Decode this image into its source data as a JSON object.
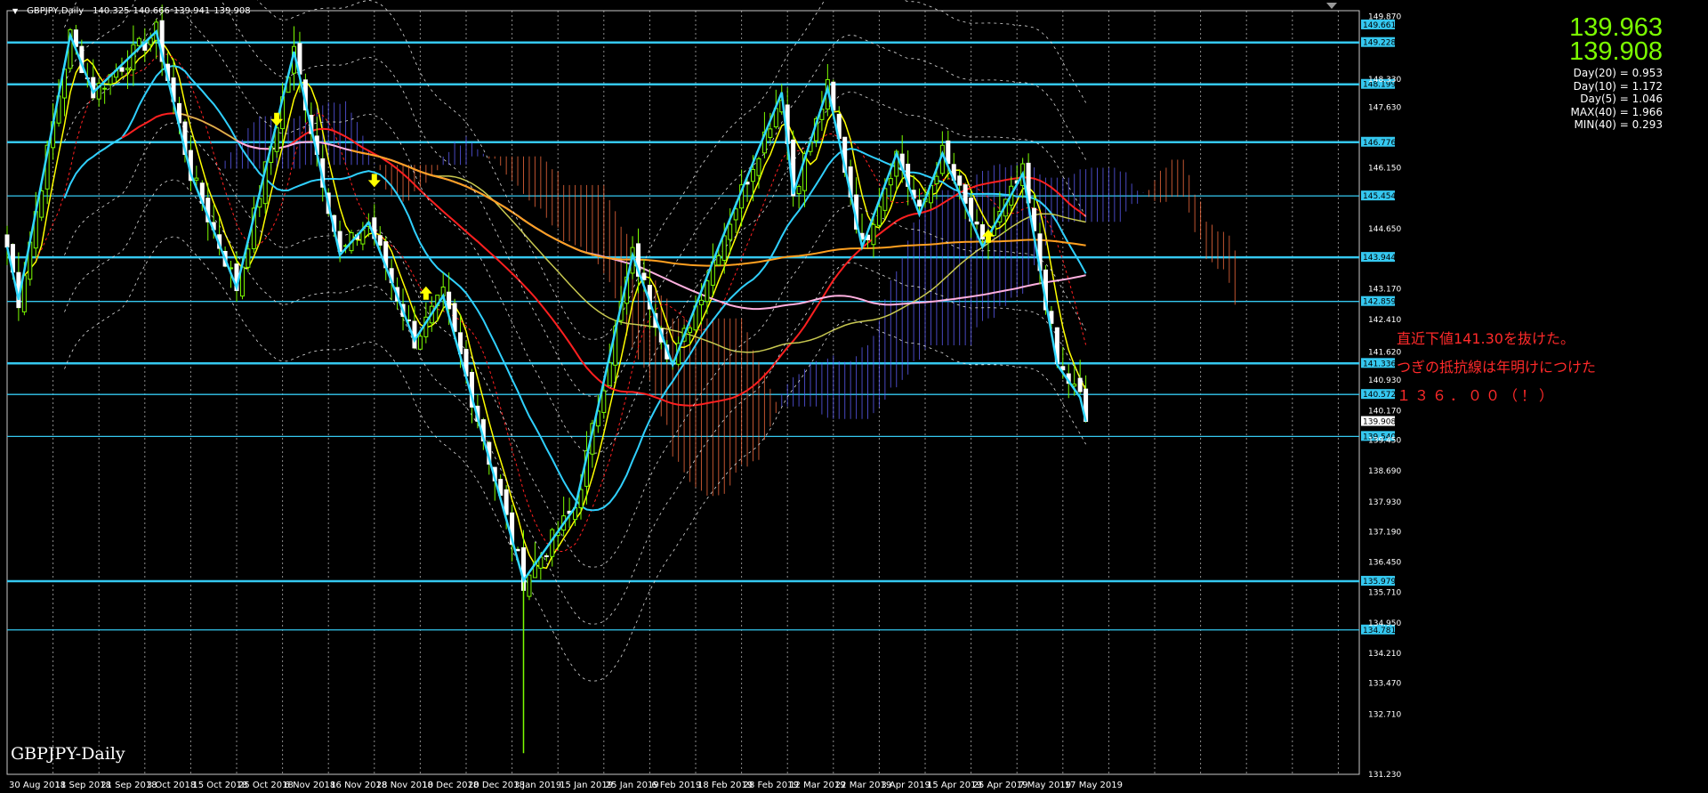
{
  "header": {
    "symbol": "GBPJPY,Daily",
    "open": "140.325",
    "high": "140.666",
    "low": "139.941",
    "close": "139.908"
  },
  "big_prices": {
    "ask": "139.963",
    "bid": "139.908"
  },
  "stats": [
    "Day(20) = 0.953",
    "Day(10) = 1.172",
    "Day(5) = 1.046",
    "MAX(40) = 1.966",
    "MIN(40) = 0.293"
  ],
  "annotation": {
    "line1": "直近下値141.30を抜けた。",
    "line2": "つぎの抵抗線は年明けにつけた",
    "line3": "１３６．００（！）"
  },
  "watermark": "GBPJPY-Daily",
  "colors": {
    "background": "#000000",
    "grid": "#c8c8c8",
    "level_line": "#35c8f0",
    "bull_candle": "#7cfc00",
    "bear_candle": "#ffffff",
    "big_price": "#7cfc00",
    "annotation": "#ff2a2a",
    "ma_yellow": "#ffff00",
    "ma_red": "#ff2020",
    "ma_cyan": "#30d0ff",
    "ma_orange": "#ffa020",
    "ma_pink": "#ffb0e0",
    "ma_olive": "#c8c850",
    "cloud_bull": "#6060ff",
    "cloud_bear": "#ff7040",
    "arrow": "#ffff00"
  },
  "chart_data": {
    "type": "candlestick",
    "title": "GBPJPY,Daily",
    "y_range": [
      131.23,
      150.01
    ],
    "y_ticks": [
      "149.870",
      "148.330",
      "147.630",
      "146.150",
      "144.650",
      "143.170",
      "142.410",
      "141.620",
      "140.930",
      "140.170",
      "139.450",
      "138.690",
      "137.930",
      "137.190",
      "136.450",
      "135.710",
      "134.950",
      "134.210",
      "133.470",
      "132.710",
      "131.230"
    ],
    "x_labels": [
      "30 Aug 2018",
      "11 Sep 2018",
      "21 Sep 2018",
      "3 Oct 2018",
      "15 Oct 2018",
      "25 Oct 2018",
      "6 Nov 2018",
      "16 Nov 2018",
      "28 Nov 2018",
      "10 Dec 2018",
      "20 Dec 2018",
      "3 Jan 2019",
      "15 Jan 2019",
      "25 Jan 2019",
      "6 Feb 2019",
      "18 Feb 2019",
      "28 Feb 2019",
      "12 Mar 2019",
      "22 Mar 2019",
      "3 Apr 2019",
      "15 Apr 2019",
      "25 Apr 2019",
      "7 May 2019",
      "17 May 2019"
    ],
    "x_label_days": [
      0,
      8,
      16,
      24,
      32,
      40,
      48,
      56,
      64,
      72,
      80,
      88,
      96,
      104,
      112,
      120,
      128,
      136,
      144,
      152,
      160,
      168,
      176,
      184
    ],
    "grid": "dotted vertical",
    "levels": [
      {
        "label": "149.661",
        "value": 149.661,
        "line": false
      },
      {
        "label": "149.228",
        "value": 149.228,
        "line": true
      },
      {
        "label": "148.199",
        "value": 148.199,
        "line": true
      },
      {
        "label": "146.776",
        "value": 146.776,
        "line": true
      },
      {
        "label": "145.454",
        "value": 145.454,
        "line": true
      },
      {
        "label": "143.944",
        "value": 143.944,
        "line": true
      },
      {
        "label": "142.859",
        "value": 142.859,
        "line": true
      },
      {
        "label": "141.336",
        "value": 141.336,
        "line": true
      },
      {
        "label": "140.572",
        "value": 140.572,
        "line": true
      },
      {
        "label": "139.540",
        "value": 139.54,
        "line": true
      },
      {
        "label": "135.979",
        "value": 135.979,
        "line": true
      },
      {
        "label": "134.781",
        "value": 134.781,
        "line": true
      }
    ],
    "current_price": {
      "label": "139.908",
      "value": 139.908
    },
    "pivots": [
      {
        "day": 0,
        "price": 144.2
      },
      {
        "day": 2,
        "price": 142.9
      },
      {
        "day": 11,
        "price": 149.4
      },
      {
        "day": 15,
        "price": 148.0
      },
      {
        "day": 26,
        "price": 149.5
      },
      {
        "day": 32,
        "price": 146.0
      },
      {
        "day": 40,
        "price": 143.2
      },
      {
        "day": 50,
        "price": 149.0
      },
      {
        "day": 58,
        "price": 144.0
      },
      {
        "day": 63,
        "price": 144.8
      },
      {
        "day": 71,
        "price": 141.9
      },
      {
        "day": 76,
        "price": 143.0
      },
      {
        "day": 90,
        "price": 136.0
      },
      {
        "day": 99,
        "price": 137.8
      },
      {
        "day": 109,
        "price": 144.0
      },
      {
        "day": 116,
        "price": 141.3
      },
      {
        "day": 124,
        "price": 144.2
      },
      {
        "day": 135,
        "price": 148.0
      },
      {
        "day": 137,
        "price": 145.5
      },
      {
        "day": 143,
        "price": 148.1
      },
      {
        "day": 149,
        "price": 144.2
      },
      {
        "day": 155,
        "price": 146.5
      },
      {
        "day": 159,
        "price": 145.0
      },
      {
        "day": 163,
        "price": 146.5
      },
      {
        "day": 170,
        "price": 144.2
      },
      {
        "day": 177,
        "price": 146.0
      },
      {
        "day": 183,
        "price": 141.3
      },
      {
        "day": 187,
        "price": 140.5
      },
      {
        "day": 188,
        "price": 139.908
      }
    ],
    "arrows": [
      {
        "day": 47,
        "price": 147.3,
        "dir": "down"
      },
      {
        "day": 64,
        "price": 145.8,
        "dir": "down"
      },
      {
        "day": 73,
        "price": 143.1,
        "dir": "up"
      },
      {
        "day": 171,
        "price": 144.5,
        "dir": "up"
      }
    ]
  }
}
